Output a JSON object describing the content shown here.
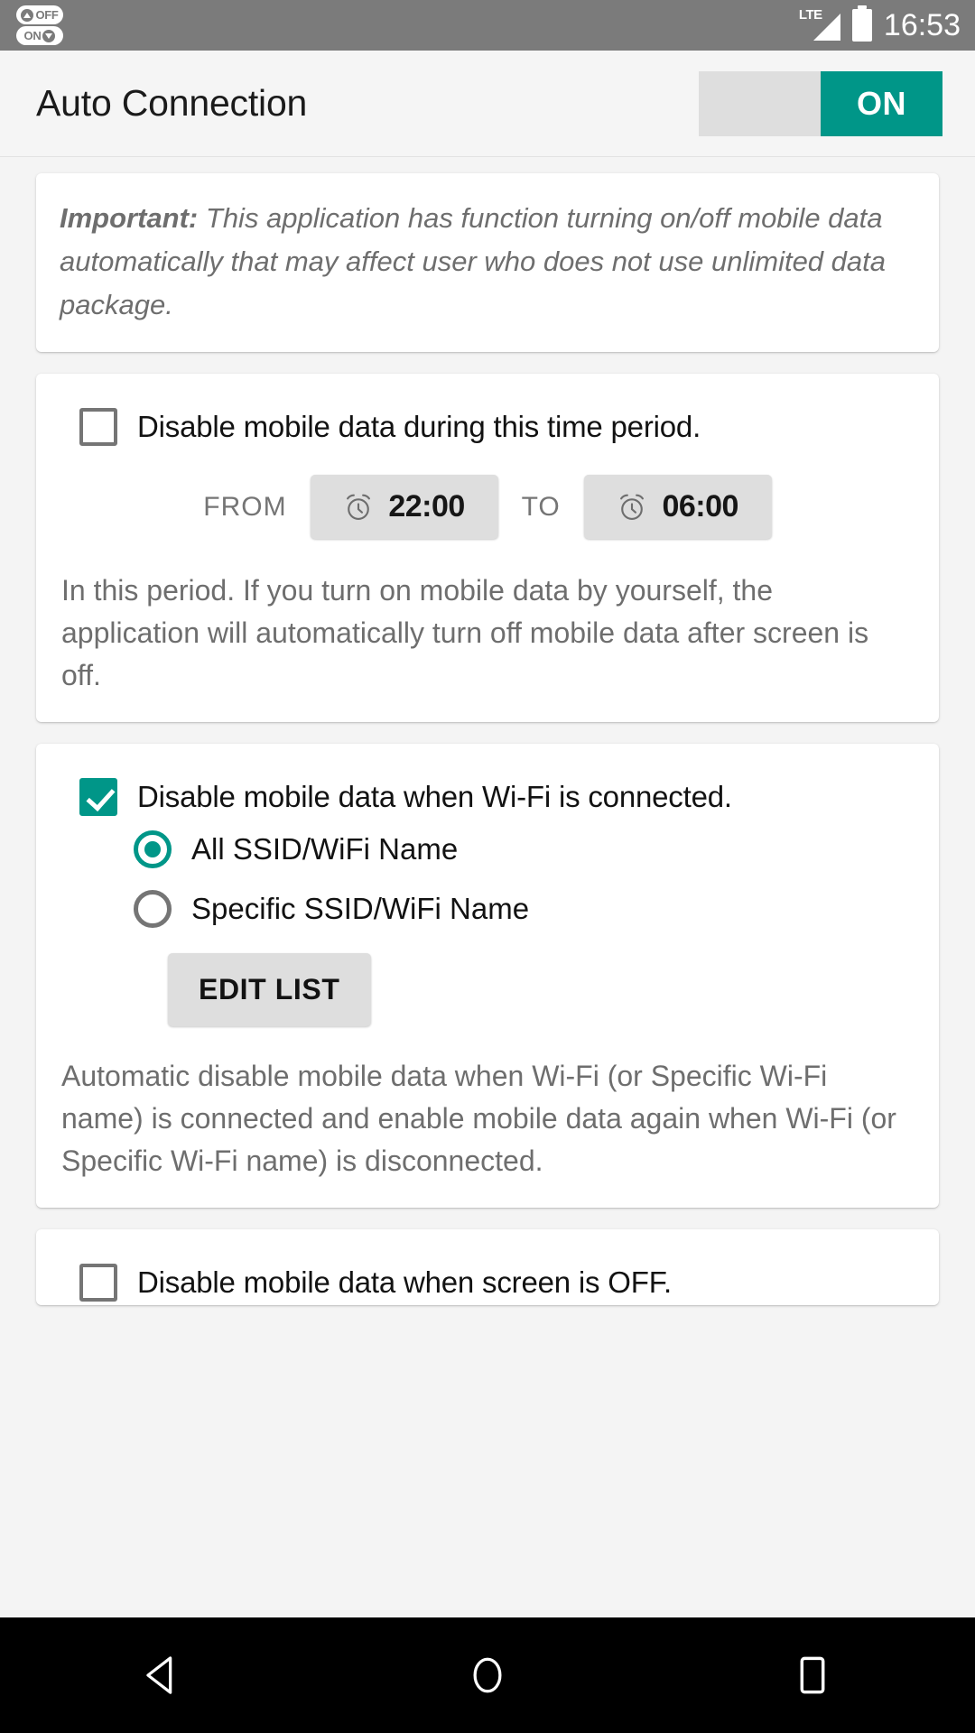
{
  "status_bar": {
    "notifications": [
      {
        "icon": "toggle-up-icon",
        "label": "OFF"
      },
      {
        "icon": "toggle-down-icon",
        "label": "ON"
      }
    ],
    "network_type": "LTE",
    "time": "16:53",
    "battery_icon": "battery-full-icon",
    "signal_icon": "signal-bars-icon"
  },
  "app_bar": {
    "title": "Auto Connection",
    "master_switch": {
      "state": "ON",
      "on_label": "ON",
      "accent_color": "#009688"
    }
  },
  "cards": {
    "important": {
      "label": "Important:",
      "body": " This application has function turning on/off mobile data automatically that may affect user who does not use unlimited data package."
    },
    "time_period": {
      "checkbox_label": "Disable mobile data during this time period.",
      "checked": false,
      "from_label": "FROM",
      "from_time": "22:00",
      "to_label": "TO",
      "to_time": "06:00",
      "description": "In this period. If you turn on mobile data by yourself, the application will automatically turn off mobile data after screen is off."
    },
    "wifi": {
      "checkbox_label": "Disable mobile data when Wi-Fi is connected.",
      "checked": true,
      "radios": [
        {
          "label": "All SSID/WiFi Name",
          "selected": true
        },
        {
          "label": "Specific SSID/WiFi Name",
          "selected": false
        }
      ],
      "edit_button": "EDIT LIST",
      "description": "Automatic disable mobile data when Wi-Fi (or Specific Wi-Fi name) is connected and enable mobile data again when Wi-Fi (or Specific Wi-Fi name) is disconnected."
    },
    "screen_off": {
      "checkbox_label": "Disable mobile data when screen is OFF.",
      "checked": false
    }
  },
  "nav_bar": {
    "back": "back-icon",
    "home": "home-icon",
    "recents": "recents-icon"
  }
}
